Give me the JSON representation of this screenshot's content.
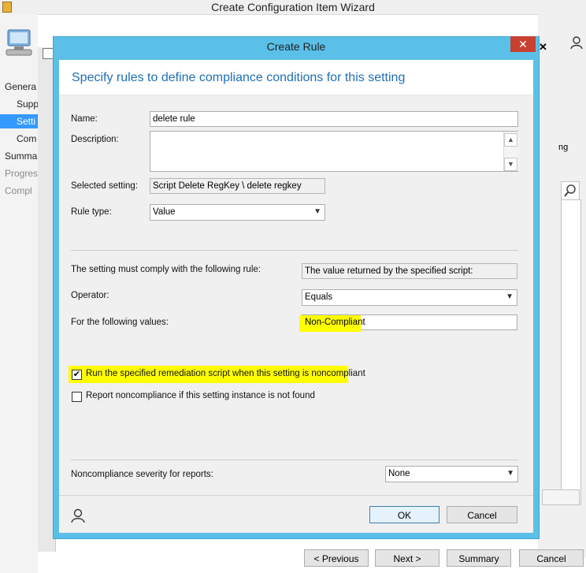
{
  "wizard": {
    "title": "Create Configuration Item Wizard",
    "nav": [
      "Genera",
      "Supp",
      "Setti",
      "Com",
      "Summa",
      "Progres",
      "Compl"
    ],
    "right_partial_label": "ng",
    "buttons": {
      "previous": "< Previous",
      "next": "Next >",
      "summary": "Summary",
      "cancel": "Cancel"
    }
  },
  "dialog": {
    "title": "Create Rule",
    "close_glyph": "✕",
    "heading": "Specify rules to define compliance conditions for this setting",
    "name_label": "Name:",
    "name_value": "delete rule",
    "description_label": "Description:",
    "description_value": "",
    "selected_setting_label": "Selected setting:",
    "selected_setting_value": "Script Delete RegKey \\ delete regkey",
    "rule_type_label": "Rule type:",
    "rule_type_value": "Value",
    "comply_label": "The setting must comply with the following rule:",
    "comply_value": "The value returned by the specified script:",
    "operator_label": "Operator:",
    "operator_value": "Equals",
    "values_label": "For the following values:",
    "values_value": "Non-Compliant",
    "remediation_label": "Run the specified remediation script when this setting is noncompliant",
    "remediation_checked": true,
    "report_label": "Report noncompliance if this setting instance is not found",
    "report_checked": false,
    "severity_label": "Noncompliance severity for reports:",
    "severity_value": "None",
    "ok_label": "OK",
    "cancel_label": "Cancel",
    "highlight_color": "#ffff00",
    "accent_color": "#5bc0e8"
  }
}
